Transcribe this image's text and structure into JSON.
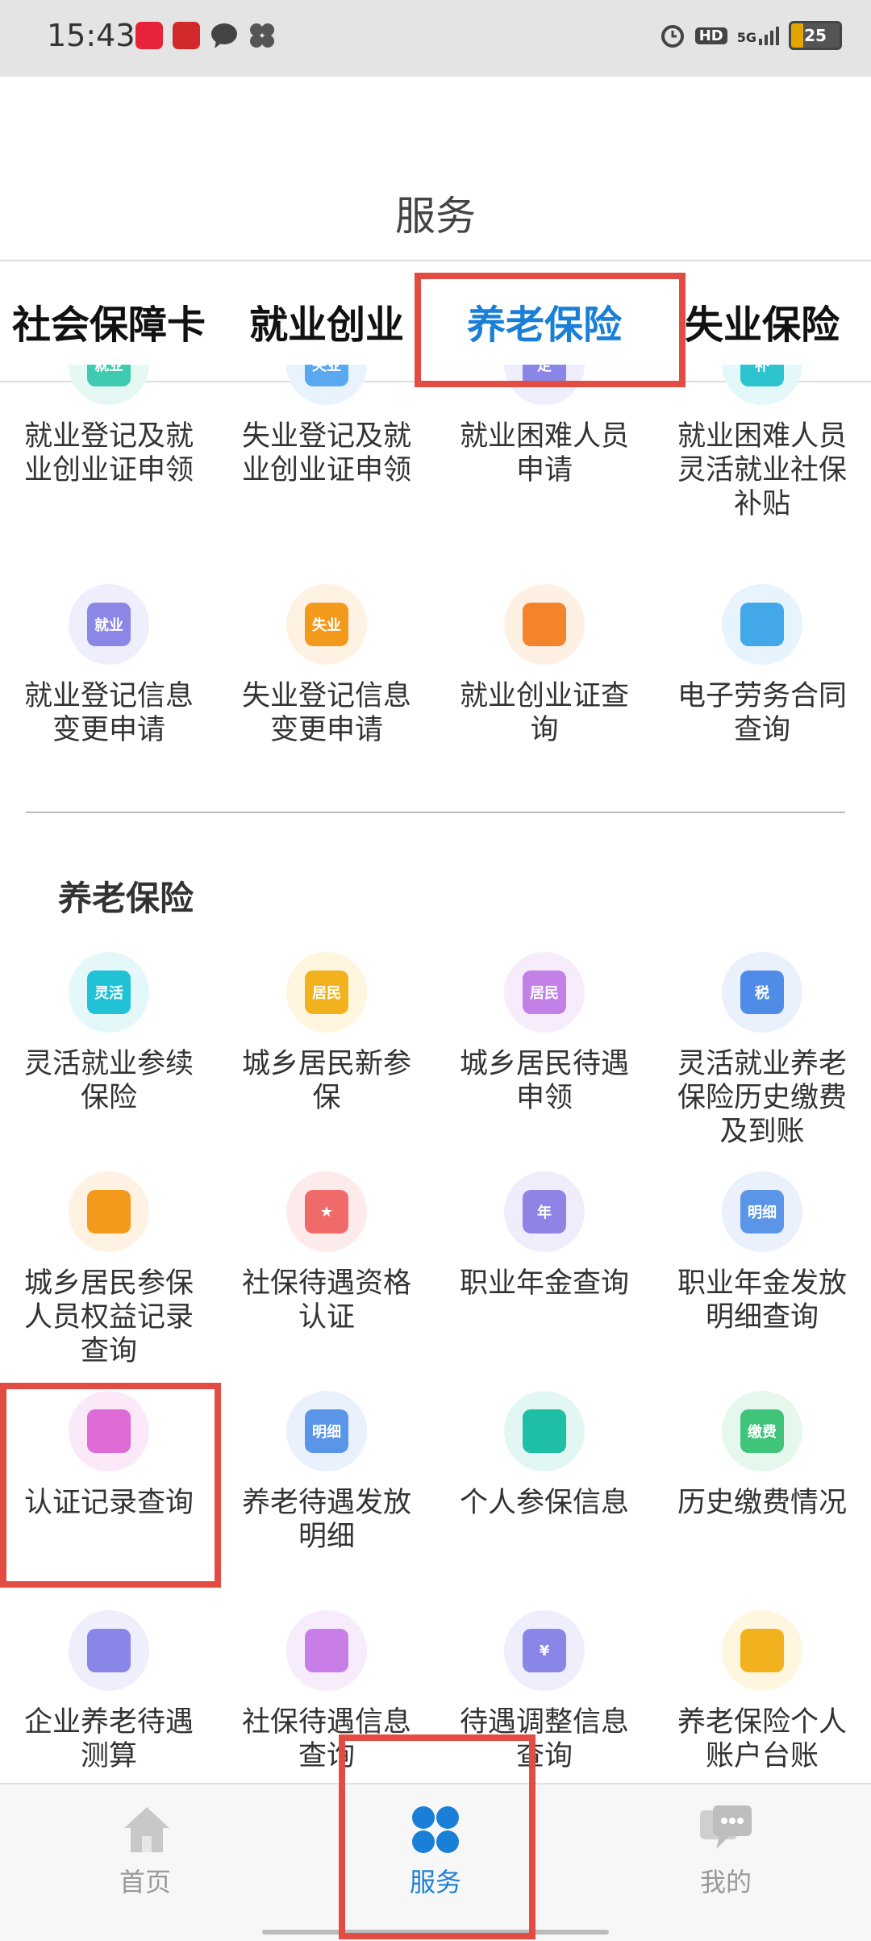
{
  "status_bar": {
    "time": "15:43",
    "battery": "25",
    "signal": "5G",
    "hd": "HD"
  },
  "page": {
    "title": "服务"
  },
  "tabs": [
    {
      "label": "社会保障卡"
    },
    {
      "label": "就业创业"
    },
    {
      "label": "养老保险"
    },
    {
      "label": "失业保险"
    }
  ],
  "employment_items": [
    {
      "label": "就业登记及就业创业证申领",
      "icon": "employment-cert-icon",
      "badge": "就业",
      "color": "#3ecbb0",
      "bg": "#e6f8f4"
    },
    {
      "label": "失业登记及就业创业证申领",
      "icon": "unemployment-cert-icon",
      "badge": "失业",
      "color": "#5aa8f0",
      "bg": "#e9f3fd"
    },
    {
      "label": "就业困难人员申请",
      "icon": "hardship-application-icon",
      "badge": "定",
      "color": "#8a86e8",
      "bg": "#efeefc"
    },
    {
      "label": "就业困难人员灵活就业社保补贴",
      "icon": "subsidy-bag-icon",
      "badge": "补",
      "color": "#2cc3cf",
      "bg": "#e4f8fa"
    },
    {
      "label": "就业登记信息变更申请",
      "icon": "employment-change-icon",
      "badge": "就业",
      "color": "#8c87e6",
      "bg": "#efeefc"
    },
    {
      "label": "失业登记信息变更申请",
      "icon": "unemployment-change-icon",
      "badge": "失业",
      "color": "#f39a1d",
      "bg": "#fff2e2"
    },
    {
      "label": "就业创业证查询",
      "icon": "cert-query-icon",
      "badge": "",
      "color": "#f3842b",
      "bg": "#fff0e4"
    },
    {
      "label": "电子劳务合同查询",
      "icon": "contract-query-icon",
      "badge": "",
      "color": "#42a8ea",
      "bg": "#e7f3fd"
    }
  ],
  "pension_section": {
    "title": "养老保险"
  },
  "pension_items": [
    {
      "label": "灵活就业参续保险",
      "icon": "flexible-insurance-icon",
      "badge": "灵活",
      "color": "#22c2d6",
      "bg": "#e4f8fa"
    },
    {
      "label": "城乡居民新参保",
      "icon": "resident-enroll-icon",
      "badge": "居民",
      "color": "#f2b21e",
      "bg": "#fff6e0"
    },
    {
      "label": "城乡居民待遇申领",
      "icon": "resident-benefit-icon",
      "badge": "居民",
      "color": "#c380e6",
      "bg": "#f6ecfc"
    },
    {
      "label": "灵活就业养老保险历史缴费及到账",
      "icon": "tax-payment-icon",
      "badge": "税",
      "color": "#4f8ce8",
      "bg": "#eaf1fd"
    },
    {
      "label": "城乡居民参保人员权益记录查询",
      "icon": "rights-record-icon",
      "badge": "",
      "color": "#f39a1d",
      "bg": "#fff2e2"
    },
    {
      "label": "社保待遇资格认证",
      "icon": "qualification-badge-icon",
      "badge": "★",
      "color": "#f06a6a",
      "bg": "#fdeaea"
    },
    {
      "label": "职业年金查询",
      "icon": "annuity-coins-icon",
      "badge": "年",
      "color": "#8f84e6",
      "bg": "#efedfc"
    },
    {
      "label": "职业年金发放明细查询",
      "icon": "annuity-detail-icon",
      "badge": "明细",
      "color": "#5b95e8",
      "bg": "#eaf1fd"
    },
    {
      "label": "认证记录查询",
      "icon": "auth-record-icon",
      "badge": "",
      "color": "#de6ad6",
      "bg": "#fbe9fa"
    },
    {
      "label": "养老待遇发放明细",
      "icon": "pension-detail-icon",
      "badge": "明细",
      "color": "#5b95e8",
      "bg": "#eaf1fd"
    },
    {
      "label": "个人参保信息",
      "icon": "personal-info-icon",
      "badge": "",
      "color": "#1fbfa6",
      "bg": "#e2f7f3"
    },
    {
      "label": "历史缴费情况",
      "icon": "payment-history-icon",
      "badge": "缴费",
      "color": "#3fc47a",
      "bg": "#e6f8ee"
    },
    {
      "label": "企业养老待遇测算",
      "icon": "pension-calc-icon",
      "badge": "",
      "color": "#8a86e8",
      "bg": "#efeefc"
    },
    {
      "label": "社保待遇信息查询",
      "icon": "benefit-info-icon",
      "badge": "",
      "color": "#c87ee6",
      "bg": "#f6ecfc"
    },
    {
      "label": "待遇调整信息查询",
      "icon": "benefit-adjust-icon",
      "badge": "¥",
      "color": "#8a86e8",
      "bg": "#efeefc"
    },
    {
      "label": "养老保险个人账户台账",
      "icon": "pension-ledger-icon",
      "badge": "",
      "color": "#f2b21e",
      "bg": "#fff6e0"
    }
  ],
  "bottom_nav": [
    {
      "label": "首页",
      "icon": "home-icon"
    },
    {
      "label": "服务",
      "icon": "services-icon"
    },
    {
      "label": "我的",
      "icon": "profile-chat-icon"
    }
  ],
  "colors": {
    "accent": "#1a7fd6",
    "highlight": "#e34c43"
  }
}
